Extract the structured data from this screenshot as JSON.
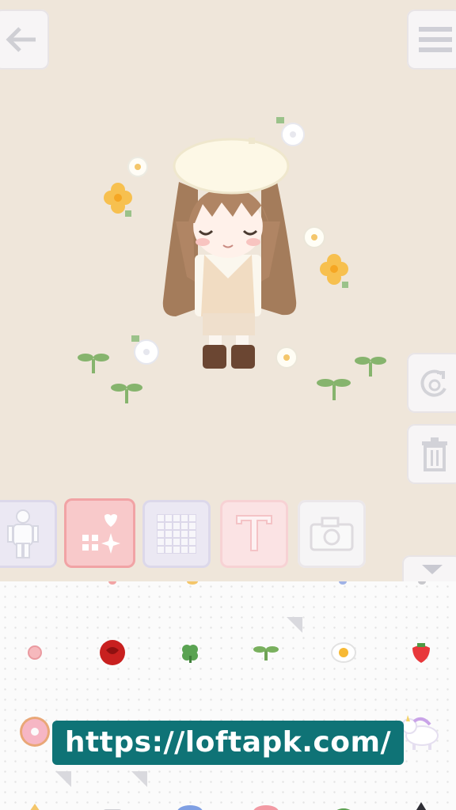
{
  "app": {
    "canvas_bg": "#efe6da",
    "accent_pink": "#f8c9ca"
  },
  "top_bar": {
    "back_icon": "arrow-left-icon",
    "menu_icon": "menu-icon"
  },
  "side_actions": {
    "rotate_icon": "rotate-icon",
    "trash_icon": "trash-icon",
    "collapse_icon": "chevron-down-icon"
  },
  "toolbar": {
    "tools": [
      {
        "name": "body",
        "icon": "person-icon",
        "selected": false
      },
      {
        "name": "stickers",
        "icon": "sparkle-heart-icon",
        "selected": true
      },
      {
        "name": "background",
        "icon": "grid-pattern-icon",
        "selected": false
      },
      {
        "name": "text",
        "icon": "text-icon",
        "selected": false,
        "glyph": "T"
      },
      {
        "name": "camera",
        "icon": "camera-icon",
        "selected": false
      }
    ]
  },
  "stickers": {
    "row": [
      {
        "icon": "pink-dot-icon"
      },
      {
        "icon": "rose-icon"
      },
      {
        "icon": "clover-icon"
      },
      {
        "icon": "sprout-icon"
      },
      {
        "icon": "fried-egg-icon"
      },
      {
        "icon": "strawberry-icon"
      }
    ],
    "row2": [
      {
        "icon": "donut-icon"
      },
      {
        "icon": "unicorn-icon"
      }
    ],
    "row3": [
      {
        "icon": "blue-macaron-icon"
      },
      {
        "icon": "pink-macaron-icon"
      },
      {
        "icon": "watermelon-icon"
      }
    ]
  },
  "watermark": {
    "url_text": "https://loftapk.com/"
  }
}
